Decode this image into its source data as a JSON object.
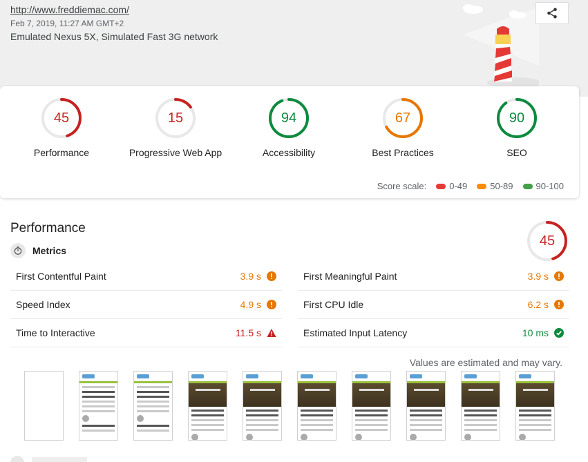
{
  "header": {
    "url": "http://www.freddiemac.com/",
    "timestamp": "Feb 7, 2019, 11:27 AM GMT+2",
    "environment": "Emulated Nexus 5X, Simulated Fast 3G network",
    "share_icon": "share-icon"
  },
  "categories": [
    {
      "label": "Performance",
      "score": "45",
      "fraction": 0.45,
      "color": "#c5221f"
    },
    {
      "label": "Progressive Web App",
      "score": "15",
      "fraction": 0.15,
      "color": "#c5221f"
    },
    {
      "label": "Accessibility",
      "score": "94",
      "fraction": 0.94,
      "color": "#0d8a3e"
    },
    {
      "label": "Best Practices",
      "score": "67",
      "fraction": 0.67,
      "color": "#e67700"
    },
    {
      "label": "SEO",
      "score": "90",
      "fraction": 0.9,
      "color": "#0d8a3e"
    }
  ],
  "scale": {
    "label": "Score scale:",
    "ranges": [
      {
        "label": "0-49",
        "color": "#e53935"
      },
      {
        "label": "50-89",
        "color": "#fb8c00"
      },
      {
        "label": "90-100",
        "color": "#43a047"
      }
    ]
  },
  "performance": {
    "title": "Performance",
    "score": "45",
    "fraction": 0.45,
    "metrics_label": "Metrics",
    "metrics_icon": "stopwatch-icon",
    "metrics": [
      {
        "name": "First Contentful Paint",
        "value": "3.9 s",
        "status": "average",
        "icon": "info-icon"
      },
      {
        "name": "First Meaningful Paint",
        "value": "3.9 s",
        "status": "average",
        "icon": "info-icon"
      },
      {
        "name": "Speed Index",
        "value": "4.9 s",
        "status": "average",
        "icon": "info-icon"
      },
      {
        "name": "First CPU Idle",
        "value": "6.2 s",
        "status": "average",
        "icon": "info-icon"
      },
      {
        "name": "Time to Interactive",
        "value": "11.5 s",
        "status": "fail",
        "icon": "warning-icon"
      },
      {
        "name": "Estimated Input Latency",
        "value": "10 ms",
        "status": "pass",
        "icon": "check-icon"
      }
    ],
    "estimate_note": "Values are estimated and may vary.",
    "filmstrip_frame_count": 10
  }
}
